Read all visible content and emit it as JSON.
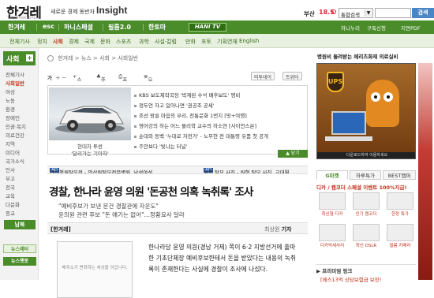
{
  "header": {
    "logo_kr": "한겨레",
    "logo_en": "THE HANKYOREH",
    "tagline": "새로운 경제 동반자",
    "insight": "Insight",
    "city": "부산",
    "temperature": "18.5",
    "search_scope": "통합검색",
    "search_placeholder": "",
    "search_button": "검색"
  },
  "nav_primary": {
    "items": [
      "한겨레",
      "esc",
      "하니스페셜",
      "필름2.0",
      "한토마"
    ],
    "hani_tv": "HANI TV",
    "right_items": [
      "하니누리",
      "구독신청",
      "지면PDF"
    ]
  },
  "nav_secondary": {
    "items": [
      "전체기사",
      "정치",
      "사회",
      "경제",
      "국제",
      "문화",
      "스포츠",
      "과학",
      "사설·칼럼",
      "만화",
      "포토",
      "기획연재",
      "English"
    ],
    "active": "사회"
  },
  "sidebar": {
    "title": "사회",
    "items": [
      "전체기사",
      "사회일반",
      "여성",
      "노동",
      "환경",
      "장애인",
      "인권·복지",
      "의료건강",
      "지역",
      "미디어",
      "국가소식",
      "인사",
      "부고",
      "전국",
      "교육",
      "다문화",
      "종교",
      "경향독자"
    ],
    "active_index": 1,
    "more_label": "남북",
    "bottom_boxes": [
      "뉴스레터",
      "뉴스챗봇"
    ]
  },
  "breadcrumb": {
    "items": [
      "한겨레",
      "뉴스",
      "사회",
      "사회일반"
    ]
  },
  "toolbar": {
    "font_label": "가",
    "scrap": "스크랩",
    "recommend": "추천",
    "print": "프린트",
    "report": "오류신고",
    "share_me2day": "미투데이",
    "share_twitter": "트위터"
  },
  "top_news": {
    "car_caption_1": "현대차 투싼",
    "car_caption_2": "'달리가는 기아차'",
    "items": [
      "KBS 보도제작국장 '박재완 수석 배후보도' 맹비",
      "정두언 자고 일어나면 '권공조 공세'",
      "조선 왕릉 마음의 부리, 전통문화 1번지 [맛+여행]",
      "영어강의 하는 어느 물리학 교수의 하소연 [사이언스온]",
      "순대와 동백 '누대로 자전거' - 노무현 전 대통령 유품 첫 공개",
      "주안보다 '빛나는 터널'"
    ],
    "collapse_label": "닫기"
  },
  "ad_bar": {
    "left_tag": "AD",
    "left_text": "안산청원탈모전 - 안산원탈모전문병원, 남성여성",
    "right_tag": "AD",
    "right_text": "원형 탈모 사진 - 원형 탈모 사진, 교대역,"
  },
  "article": {
    "headline": "경찰, 한나라 윤영 의원 '돈공천 의혹 녹취록' 조사",
    "subhead_1": "\"예비후보가 보낸 문건 경찰관에 자운도\"",
    "subhead_2": "윤의원 관련 후보 \"돈 얘기는 없어\"…정황묘사 달라",
    "source": "[한겨레]",
    "reporter_prefix": "최상원",
    "reporter_suffix": "기자",
    "photo_notice": "배주소가 변화하는 세상을 이겁니다.",
    "body_lines": [
      "한나라당 윤영 의원(경남 거제) 쪽이 6·2 지방선거에 출마",
      "한 기초단체장 예비후보한테서 돈을 받았다는 내용의 녹취",
      "록이 존재한다는 사실에 경찰이 조사에 나섰다."
    ]
  },
  "right_panel": {
    "title": "병원비 돌려받는 메리츠화재 의료실비",
    "ad_brand": "UPS",
    "ad_caption": "다운로드하여 이용하세요",
    "tabs": [
      "G마켓",
      "하루특가",
      "BEST캠퍼"
    ],
    "shop_head": "디카 / 캠코더 스페셜 이벤트 100%지급!",
    "shop_items": [
      "최신형 디카",
      "인기 캠코더",
      "한정 특가",
      "디카악세사리",
      "최신 DSLR",
      "필름 카메라"
    ],
    "premium_head": "프리미엄 링크",
    "premium_text": "[메스13억 상담보험금 보장!"
  },
  "colors": {
    "brand_green": "#4a8c2a",
    "accent_red": "#c0311b",
    "link_blue": "#1a4ba0"
  }
}
